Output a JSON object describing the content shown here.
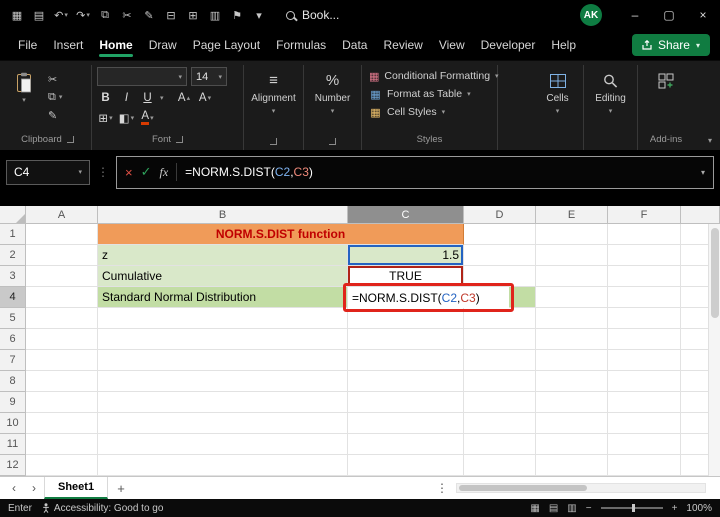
{
  "icons": {
    "caret": "▾",
    "caret_up": "▴",
    "apps": "▦",
    "save": "▤",
    "undo": "↶",
    "redo": "↷",
    "copy": "⧉",
    "cut": "✂",
    "paint": "✎",
    "print": "⊟",
    "grid": "⊞",
    "chart": "▥",
    "flag": "⚑",
    "minimize": "–",
    "maximize": "▢",
    "close": "×",
    "cancel": "×",
    "enter": "✓",
    "fx": "fx",
    "dots": "⋮",
    "menu": "≡",
    "percent": "%",
    "borders": "⊞",
    "fill": "◧",
    "left_arrow": "‹",
    "right_arrow": "›",
    "plus": "+",
    "minus": "−",
    "collapse": "▾"
  },
  "titlebar": {
    "title": "Book...",
    "avatar": "AK"
  },
  "menu": {
    "tabs": [
      "File",
      "Insert",
      "Home",
      "Draw",
      "Page Layout",
      "Formulas",
      "Data",
      "Review",
      "View",
      "Developer",
      "Help"
    ],
    "share": "Share"
  },
  "ribbon": {
    "font_size": "14",
    "bold": "B",
    "italic": "I",
    "underline": "U",
    "grow": "A",
    "shrink": "A",
    "font_color": "A",
    "labels": {
      "clipboard": "Clipboard",
      "font": "Font",
      "alignment": "Alignment",
      "number": "Number",
      "styles": "Styles",
      "cells": "Cells",
      "editing": "Editing",
      "addins": "Add-ins",
      "conditional": "Conditional Formatting",
      "format_table": "Format as Table",
      "cell_styles": "Cell Styles"
    }
  },
  "formula": {
    "name_box": "C4",
    "prefix": "=NORM.S.DIST(",
    "ref1": "C2",
    "comma": ",",
    "ref2": "C3",
    "suffix": ")"
  },
  "sheet": {
    "columns": [
      "A",
      "B",
      "C",
      "D",
      "E",
      "F"
    ],
    "rows": [
      "1",
      "2",
      "3",
      "4",
      "5",
      "6",
      "7",
      "8",
      "9",
      "10",
      "11",
      "12"
    ],
    "cells": {
      "title": "NORM.S.DIST function",
      "b2": "z",
      "c2": "1.5",
      "b3": "Cumulative",
      "c3": "TRUE",
      "b4": "Standard Normal Distribution"
    },
    "tab": "Sheet1"
  },
  "status": {
    "mode": "Enter",
    "accessibility": "Accessibility: Good to go",
    "zoom": "100%"
  },
  "colors": {
    "accent_green": "#107C41",
    "ref_blue": "#2463C2",
    "ref_red": "#C0392B",
    "annotation_red": "#E0241B",
    "header_fill": "#F09B59",
    "header_text": "#C00000",
    "cell_green": "#D9E8C9",
    "cell_green_dark": "#C2DDA4"
  }
}
